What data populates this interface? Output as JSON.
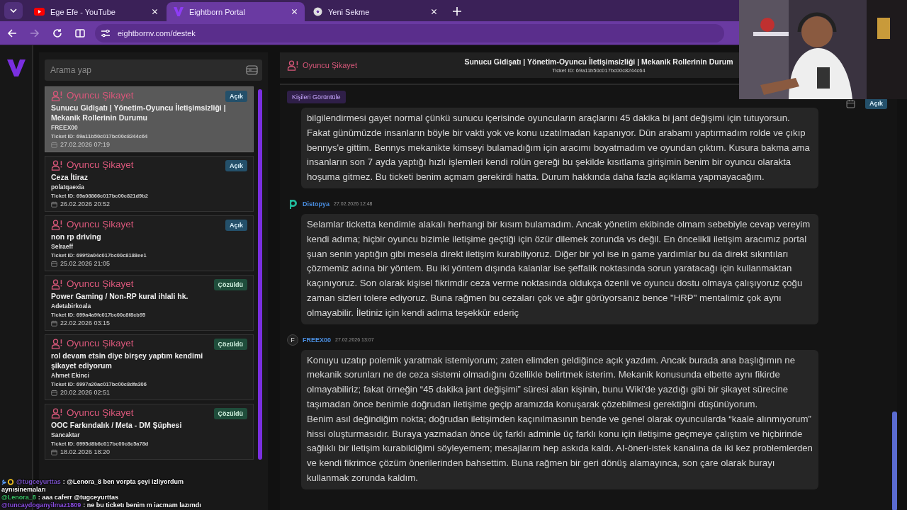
{
  "browser": {
    "tabs": [
      {
        "title": "Ege Efe - YouTube",
        "kind": "video",
        "selected": false
      },
      {
        "title": "Eightborn Portal",
        "kind": "portal",
        "selected": true
      },
      {
        "title": "Yeni Sekme",
        "kind": "newtab",
        "selected": false
      }
    ],
    "url": "eightbornv.com/destek"
  },
  "search": {
    "placeholder": "Arama yap"
  },
  "tickets": [
    {
      "category": "Oyuncu Şikayet",
      "title": "Sunucu Gidişatı | Yönetim-Oyuncu İletişimsizliği | Mekanik Rollerinin Durumu",
      "author": "FREEX00",
      "ticket_id": "Ticket ID: 69a11b50c017bc00c8244c64",
      "date": "27.02.2026 07:19",
      "status": {
        "label": "Açık",
        "kind": "open"
      },
      "selected": true
    },
    {
      "category": "Oyuncu Şikayet",
      "title": "Ceza İtiraz",
      "author": "polatqaexia",
      "ticket_id": "Ticket ID: 69a08866c017bc00c821d9b2",
      "date": "26.02.2026 20:52",
      "status": {
        "label": "Açık",
        "kind": "open"
      },
      "selected": false
    },
    {
      "category": "Oyuncu Şikayet",
      "title": "non rp driving",
      "author": "Selraeff",
      "ticket_id": "Ticket ID: 699f3a04c017bc00c8188ee1",
      "date": "25.02.2026 21:05",
      "status": {
        "label": "Açık",
        "kind": "open"
      },
      "selected": false
    },
    {
      "category": "Oyuncu Şikayet",
      "title": "Power Gaming / Non-RP kural ihlali hk.",
      "author": "Adetabirkoala",
      "ticket_id": "Ticket ID: 699a4a9fc017bc00c8f8cb95",
      "date": "22.02.2026 03:15",
      "status": {
        "label": "Çözüldü",
        "kind": "resolved"
      },
      "selected": false
    },
    {
      "category": "Oyuncu Şikayet",
      "title": "rol devam etsin diye birşey yaptım kendimi şikayet ediyorum",
      "author": "Ahmet Ekinci",
      "ticket_id": "Ticket ID: 6997a20ac017bc00c8dfa306",
      "date": "20.02.2026 02:51",
      "status": {
        "label": "Çözüldü",
        "kind": "resolved"
      },
      "selected": false
    },
    {
      "category": "Oyuncu Şikayet",
      "title": "OOC Farkındalık / Meta - DM Şüphesi",
      "author": "Sancaktar",
      "ticket_id": "Ticket ID: 6995d8b6c017bc00c8c5a78d",
      "date": "18.02.2026 18:20",
      "status": {
        "label": "Çözüldü",
        "kind": "resolved"
      },
      "selected": false
    }
  ],
  "detail": {
    "category": "Oyuncu Şikayet",
    "title": "Sunucu Gidişatı | Yönetim-Oyuncu İletişimsizliği | Mekanik Rollerinin Durum",
    "ticket_id": "Ticket ID: 69a11b50c017bc00c8244c64",
    "view_people_button": "Kişileri Görüntüle",
    "status": {
      "label": "Açık",
      "kind": "open"
    },
    "messages": [
      {
        "paragraphs": [
          "bilgilendirmesi gayet normal çünkü sunucu içerisinde oyuncuların araçlarını 45 dakika bi jant değişimi için tutuyorsun. Fakat günümüzde insanların böyle bir vakti yok ve konu uzatılmadan kapanıyor. Dün arabamı yaptırmadım rolde ve çıkıp bennys'e gittim. Bennys mekanikte kimseyi bulamadığım için aracımı boyatmadım ve oyundan çıktım. Kusura bakma ama insanların son 7 ayda yaptığı hızlı işlemleri kendi rolün gereği bu şekilde kısıtlama girişimin benim bir oyuncu olarakta hoşuma gitmez. Bu ticketi benim açmam gerekirdi hatta. Durum hakkında daha fazla açıklama yapmayacağım."
        ]
      },
      {
        "author": "Distopya",
        "time": "27.02.2026 12:48",
        "avatar": {
          "kind": "logo"
        },
        "paragraphs": [
          "Selamlar ticketta kendimle alakalı herhangi bir kısım bulamadım. Ancak yönetim ekibinde olmam sebebiyle cevap vereyim kendi adıma; hiçbir oyuncu bizimle iletişime geçtiği için özür dilemek zorunda vs değil. En öncelikli iletişim aracımız portal şuan senin yaptığın gibi mesela direkt iletişim kurabiliyoruz. Diğer bir yol ise in game yardımlar bu da direkt sıkıntıları çözmemiz adına bir yöntem. Bu iki yöntem dışında kalanlar ise şeffalik noktasında sorun yaratacağı için kullanmaktan kaçınıyoruz. Son olarak kişisel fikrimdir ceza verme noktasında oldukça özenli ve oyuncu dostu olmaya çalışıyoruz çoğu zaman sizleri tolere ediyoruz. Buna rağmen bu cezaları çok ve ağır görüyorsanız bence \"HRP\" mentalimiz çok aynı olmayabilir. İletiniz için kendi adıma teşekkür ederiç"
        ]
      },
      {
        "author": "FREEX00",
        "time": "27.02.2026 13:07",
        "avatar": {
          "kind": "letter",
          "letter": "F"
        },
        "paragraphs": [
          "Konuyu uzatıp polemik yaratmak istemiyorum; zaten elimden geldiğince açık yazdım. Ancak burada ana başlığımın ne mekanik sorunları ne de ceza sistemi olmadığını özellikle belirtmek isterim. Mekanik konusunda elbette aynı fikirde olmayabiliriz; fakat örneğin “45 dakika jant değişimi” süresi alan kişinin, bunu Wiki'de yazdığı gibi bir şikayet sürecine taşımadan önce benimle doğrudan iletişime geçip aramızda konuşarak çözebilmesi gerektiğini düşünüyorum.",
          "Benim asıl değindiğim nokta; doğrudan iletişimden kaçınılmasının bende ve genel olarak oyuncularda “kaale alınmıyorum” hissi oluşturmasıdır. Buraya yazmadan önce üç farklı adminle üç farklı konu için iletişime geçmeye çalıştım ve hiçbirinde sağlıklı bir iletişim kurabildiğimi söyleyemem; mesajlarım hep askıda kaldı. AI-öneri-istek kanalına da iki kez problemlerden ve kendi fikrimce çözüm önerilerinden bahsettim. Buna rağmen bir geri dönüş alamayınca, son çare olarak burayı kullanmak zorunda kaldım."
        ]
      }
    ]
  },
  "stream_chat": [
    {
      "user": "@tugceyurttas",
      "color": "#7b52c9",
      "badges": true,
      "text": ": @Lenora_8 ben vorpta şeyi izliyordum"
    },
    {
      "text": "aynısinemaları",
      "badges": false
    },
    {
      "user": "@Lenora_8",
      "color": "#3cc46a",
      "badges": false,
      "text": ": aaa caferr @tugceyurttas"
    },
    {
      "user": "@tuncaydoganyilmaz1809",
      "color": "#8a4ee0",
      "badges": false,
      "text": ": ne bu ticketı benim m iacmam lazımdı"
    }
  ]
}
